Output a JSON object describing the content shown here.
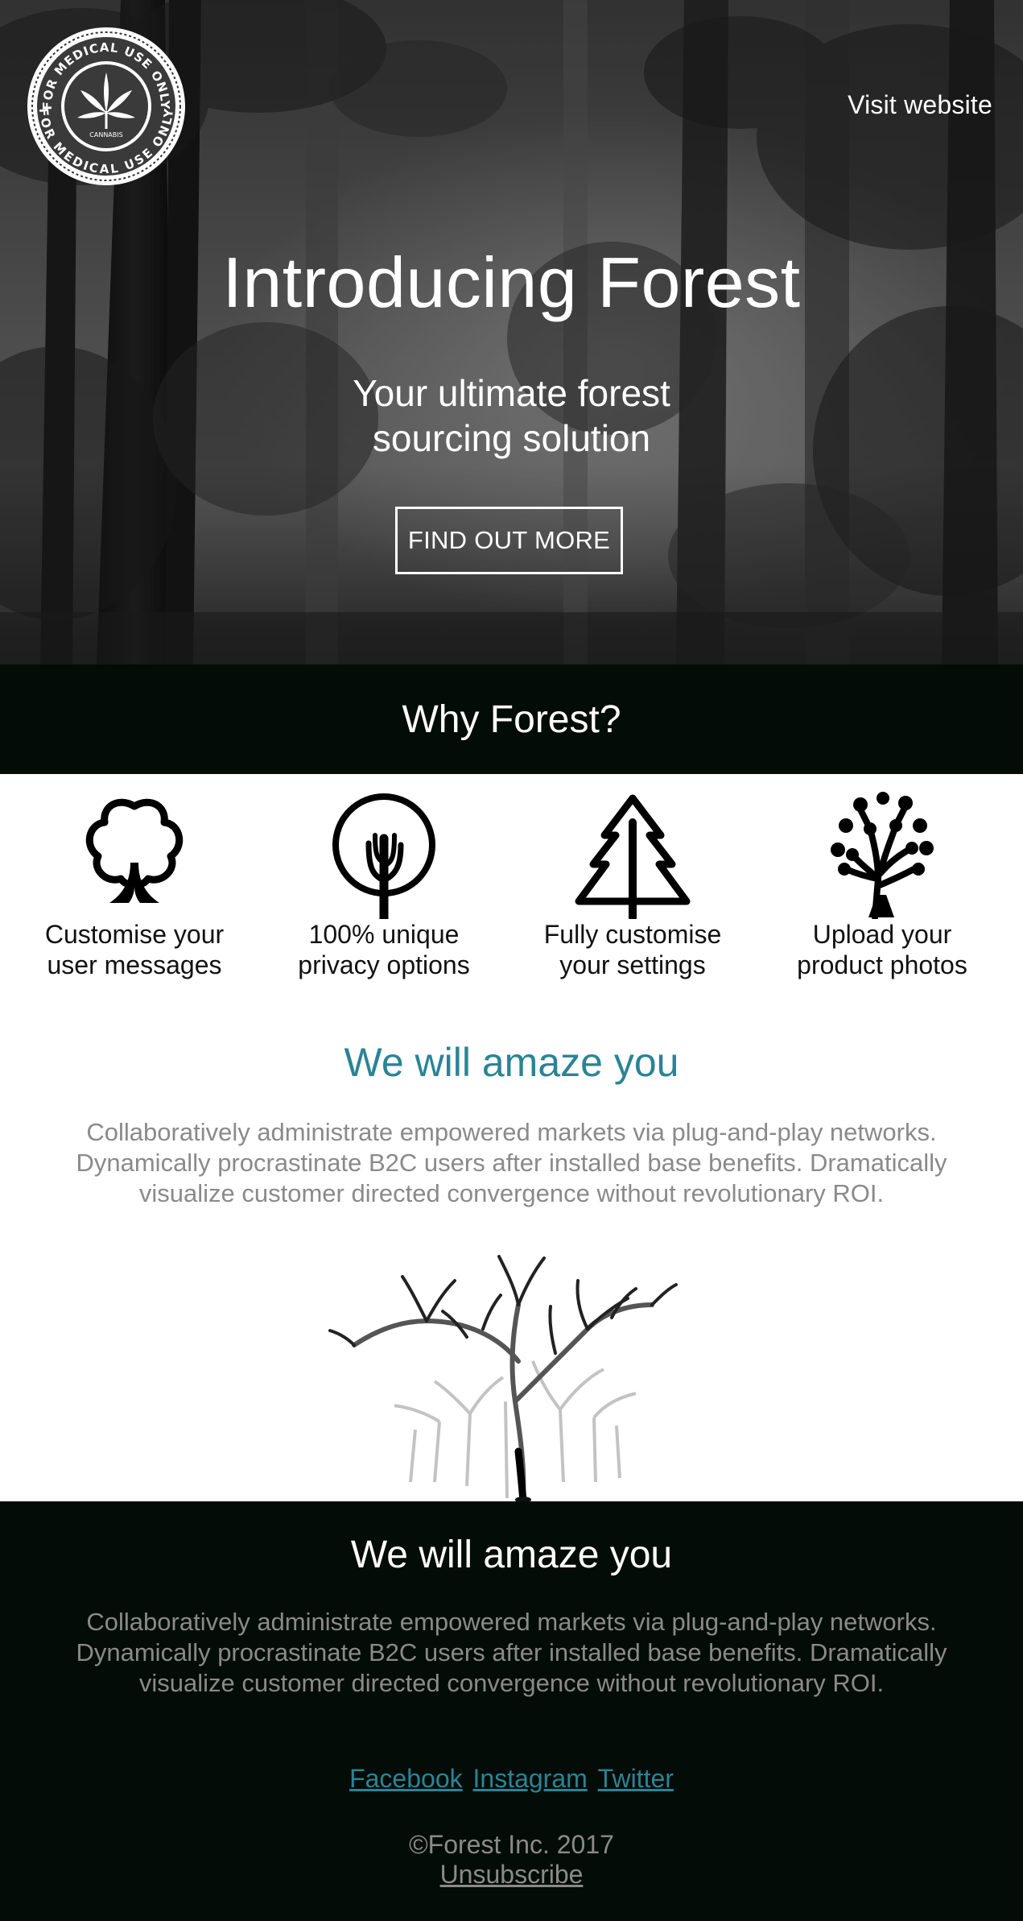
{
  "colors": {
    "accent": "#2a8496",
    "dark_band": "#040c07",
    "muted_text": "#8a8a8a",
    "white": "#ffffff"
  },
  "header": {
    "badge_top_text": "FOR MEDICAL USE ONLY",
    "badge_bottom_text": "FOR MEDICAL USE ONLY",
    "badge_center_text": "CANNABIS",
    "badge_icon": "cannabis-leaf-icon",
    "visit_link": "Visit website"
  },
  "hero": {
    "title": "Introducing Forest",
    "subtitle_line1": "Your ultimate forest",
    "subtitle_line2": "sourcing solution",
    "cta_label": "FIND OUT MORE"
  },
  "why": {
    "title": "Why Forest?"
  },
  "features": [
    {
      "icon": "bushy-tree-icon",
      "line1": "Customise your",
      "line2": "user messages"
    },
    {
      "icon": "round-tree-icon",
      "line1": "100% unique",
      "line2": "privacy options"
    },
    {
      "icon": "pine-tree-icon",
      "line1": "Fully customise",
      "line2": "your settings"
    },
    {
      "icon": "fruit-tree-icon",
      "line1": "Upload your",
      "line2": "product photos"
    }
  ],
  "amaze": {
    "title": "We will amaze you",
    "line1": "Collaboratively administrate empowered markets via plug-and-play networks.",
    "line2": "Dynamically procrastinate B2C users after installed base benefits. Dramatically",
    "line3": "visualize customer directed convergence without revolutionary ROI."
  },
  "footer": {
    "title": "We will amaze you",
    "line1": "Collaboratively administrate empowered markets via plug-and-play networks.",
    "line2": "Dynamically procrastinate B2C users after installed base benefits. Dramatically",
    "line3": "visualize customer directed convergence without revolutionary ROI.",
    "social": [
      "Facebook",
      "Instagram",
      "Twitter"
    ],
    "copyright": "©Forest Inc. 2017",
    "unsubscribe": "Unsubscribe"
  }
}
